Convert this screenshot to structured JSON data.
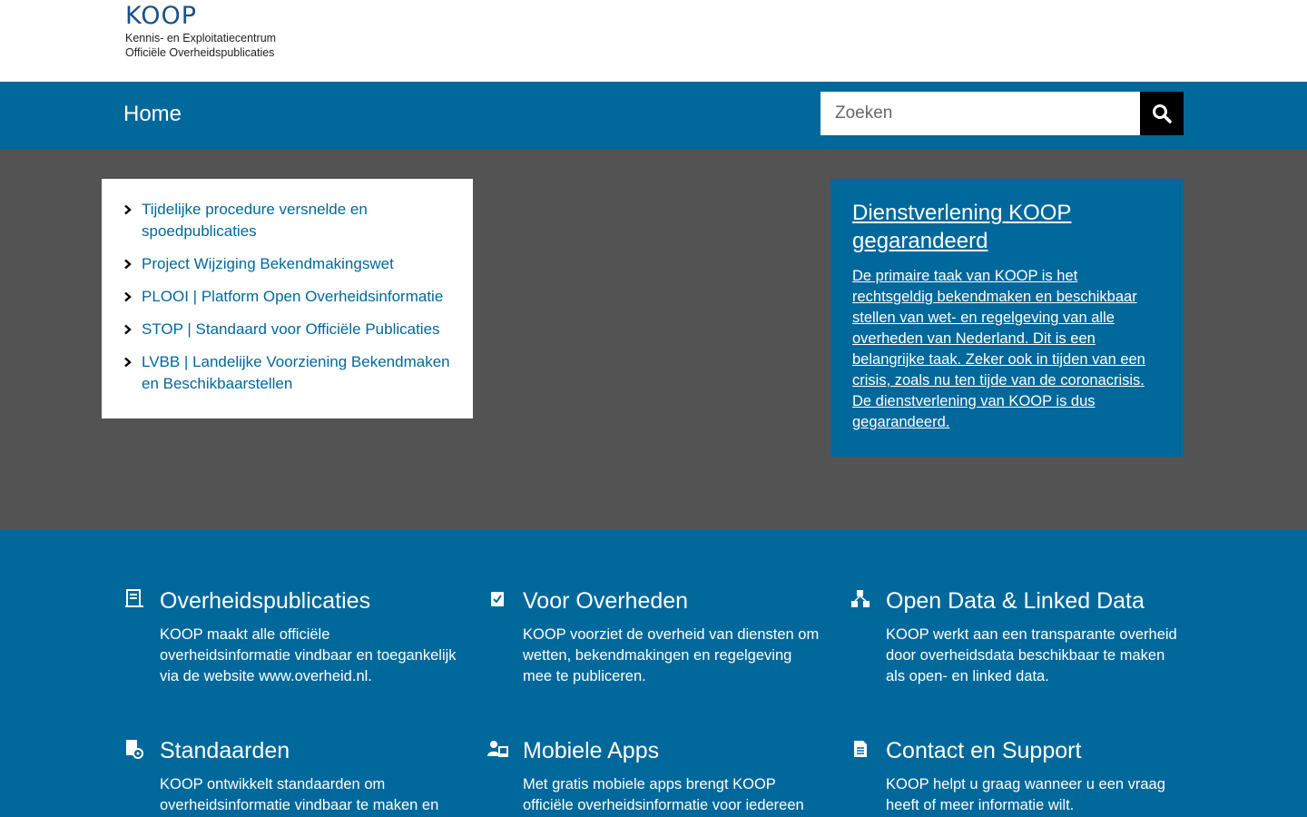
{
  "header": {
    "logo_word": "KOOP",
    "logo_line1": "Kennis- en Exploitatiecentrum",
    "logo_line2": "Officiële Overheidspublicaties"
  },
  "nav": {
    "home_label": "Home",
    "search_placeholder": "Zoeken",
    "search_icon": "search-icon"
  },
  "links": [
    {
      "label": "Tijdelijke procedure versnelde en spoedpublicaties"
    },
    {
      "label": "Project Wijziging Bekendmakingswet"
    },
    {
      "label": "PLOOI | Platform Open Overheidsinformatie"
    },
    {
      "label": "STOP | Standaard voor Officiële Publicaties"
    },
    {
      "label": "LVBB | Landelijke Voorziening Bekendmaken en Beschikbaarstellen"
    }
  ],
  "promo": {
    "title": "Dienstverlening KOOP gegarandeerd",
    "text": "De primaire taak van KOOP is het rechtsgeldig bekendmaken en beschikbaar stellen van wet- en regelgeving van alle overheden van Nederland. Dit is een belangrijke taak. Zeker ook in tijden van een crisis, zoals nu ten tijde van de coronacrisis. De dienstverlening van KOOP is dus gegarandeerd."
  },
  "features": [
    {
      "title": "Overheidspublicaties",
      "text": "KOOP maakt alle officiële overheidsinformatie vindbaar en toegankelijk via de website www.overheid.nl.",
      "icon": "document-icon"
    },
    {
      "title": "Voor Overheden",
      "text": "KOOP voorziet de overheid van diensten om wetten, bekendmakingen en regelgeving mee te publiceren.",
      "icon": "checklist-icon"
    },
    {
      "title": "Open Data & Linked Data",
      "text": "KOOP werkt aan een transparante overheid door overheidsdata beschikbaar te maken als open- en linked data.",
      "icon": "linked-data-icon"
    },
    {
      "title": "Standaarden",
      "text": "KOOP ontwikkelt standaarden om overheidsinformatie vindbaar te maken en",
      "icon": "standard-document-icon"
    },
    {
      "title": "Mobiele Apps",
      "text": "Met gratis mobiele apps brengt KOOP officiële overheidsinformatie voor iedereen",
      "icon": "mobile-apps-icon"
    },
    {
      "title": "Contact en Support",
      "text": "KOOP helpt u graag wanneer u een vraag heeft of meer informatie wilt.",
      "icon": "support-document-icon"
    }
  ],
  "colors": {
    "brand_blue": "#01689b",
    "hero_gray": "#535353"
  }
}
